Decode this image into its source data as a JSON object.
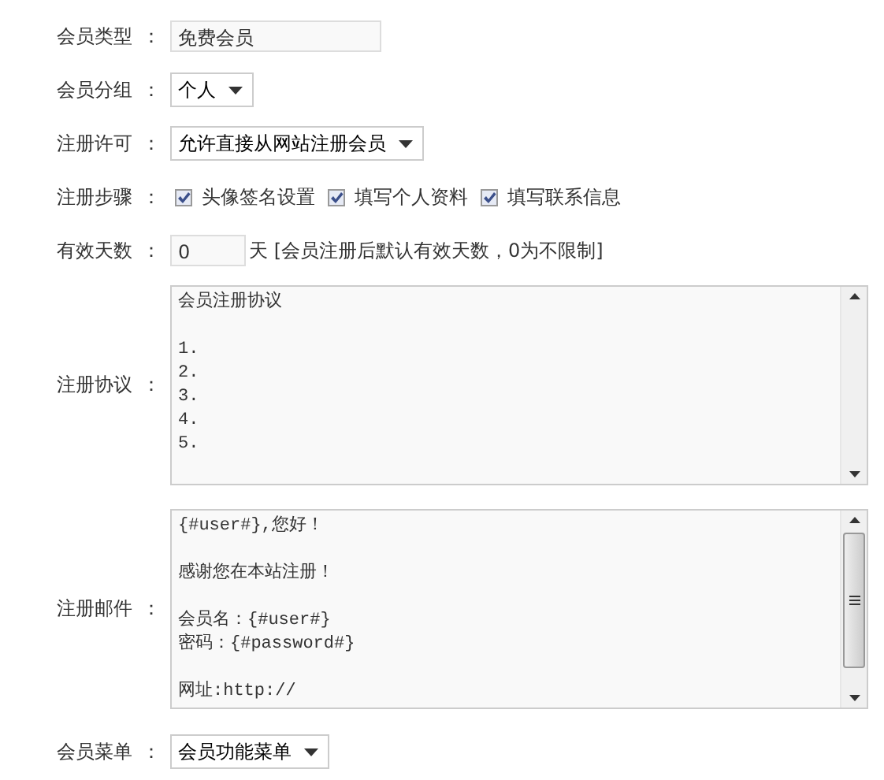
{
  "fields": [
    {
      "label": "会员类型",
      "colon": "：",
      "kind": "text",
      "value": "免费会员"
    },
    {
      "label": "会员分组",
      "colon": "：",
      "kind": "select",
      "value": "个人"
    },
    {
      "label": "注册许可",
      "colon": "：",
      "kind": "select",
      "value": "允许直接从网站注册会员"
    },
    {
      "label": "注册步骤",
      "colon": "：",
      "kind": "checks",
      "options": [
        {
          "label": "头像签名设置",
          "checked": true
        },
        {
          "label": "填写个人资料",
          "checked": true
        },
        {
          "label": "填写联系信息",
          "checked": true
        }
      ]
    },
    {
      "label": "有效天数",
      "colon": "：",
      "kind": "number",
      "value": "0",
      "suffix": "天 [会员注册后默认有效天数，0为不限制]"
    },
    {
      "label": "注册协议",
      "colon": "：",
      "kind": "textarea",
      "scrollable": false,
      "paragraphs": [
        [
          "会员注册协议"
        ],
        [
          "1.",
          "2.",
          "3.",
          "4.",
          "5."
        ]
      ]
    },
    {
      "label": "注册邮件",
      "colon": "：",
      "kind": "textarea",
      "scrollable": true,
      "paragraphs": [
        [
          "{#user#},您好！"
        ],
        [
          "感谢您在本站注册！"
        ],
        [
          "会员名：{#user#}",
          "密码：{#password#}"
        ],
        [
          "网址:http://"
        ]
      ]
    },
    {
      "label": "会员菜单",
      "colon": "：",
      "kind": "select",
      "value": "会员功能菜单"
    }
  ]
}
